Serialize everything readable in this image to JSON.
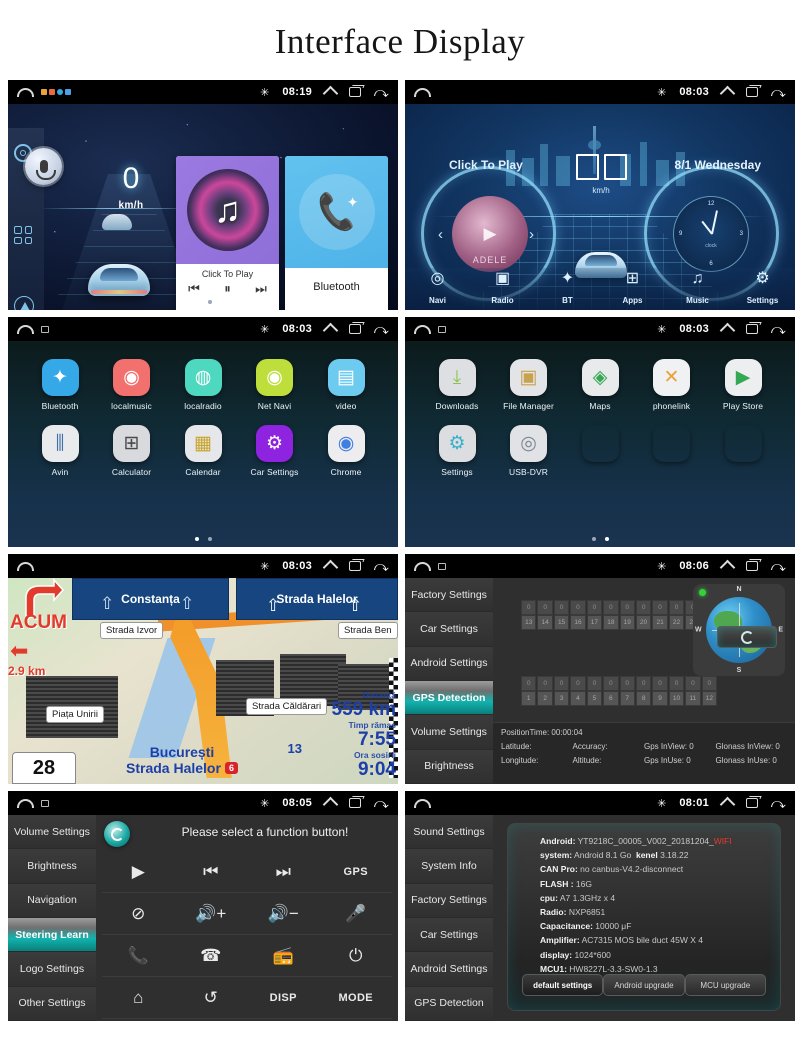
{
  "page": {
    "title": "Interface Display"
  },
  "status_bar": {
    "home_icon": "home-arc-icon",
    "recents_icon": "recents-icon",
    "back_icon": "back-icon",
    "bluetooth_icon": "bluetooth-icon",
    "expand_icon": "chevron-up-icon",
    "times": {
      "p1": "08:19",
      "p2": "08:03",
      "p3": "08:03",
      "p4": "08:03",
      "p5": "08:03",
      "p6": "08:06",
      "p7": "08:05",
      "p8": "08:01"
    }
  },
  "panel1": {
    "name": "home-screen",
    "sidebar": [
      {
        "name": "gear-icon",
        "label": "Settings"
      },
      {
        "name": "mic-icon",
        "label": "Voice"
      },
      {
        "name": "apps-grid-icon",
        "label": "Apps"
      },
      {
        "name": "navigation-icon",
        "label": "Navi"
      }
    ],
    "speed": {
      "value": "0",
      "unit": "km/h"
    },
    "music_widget": {
      "caption": "Click To Play",
      "prev": "⏮",
      "play_pause": "⏸",
      "next": "⏭"
    },
    "bluetooth_widget": {
      "label": "Bluetooth"
    },
    "page_dots": 2,
    "active_dot": 0
  },
  "panel2": {
    "name": "dashboard-screen",
    "click_to_play": "Click To Play",
    "date": "8/1  Wednesday",
    "speed_unit": "km/h",
    "album_name": "ADELE",
    "clock_label": "clock",
    "clock_ticks": [
      "12",
      "3",
      "6",
      "9"
    ],
    "nav_items": [
      {
        "label": "Navi",
        "icon": "location-pin-icon",
        "glyph": "◎"
      },
      {
        "label": "Radio",
        "icon": "radio-icon",
        "glyph": "▣"
      },
      {
        "label": "BT",
        "icon": "bluetooth-icon",
        "glyph": "✦"
      },
      {
        "label": "Apps",
        "icon": "apps-grid-icon",
        "glyph": "⊞"
      },
      {
        "label": "Music",
        "icon": "music-note-icon",
        "glyph": "♫"
      },
      {
        "label": "Settings",
        "icon": "gear-icon",
        "glyph": "⚙"
      }
    ]
  },
  "panel3": {
    "name": "app-drawer-page-1",
    "rows": [
      [
        {
          "label": "Bluetooth",
          "icon": "bluetooth-icon",
          "glyph": "✦",
          "bg": "#35a9e8",
          "fg": "#ffffff"
        },
        {
          "label": "localmusic",
          "icon": "music-play-icon",
          "glyph": "◉",
          "bg": "#f2706e",
          "fg": "#ffffff"
        },
        {
          "label": "localradio",
          "icon": "radio-icon",
          "glyph": "◍",
          "bg": "#4ed8bf",
          "fg": "#ffffff"
        },
        {
          "label": "Net Navi",
          "icon": "location-pin-icon",
          "glyph": "◉",
          "bg": "#bede3c",
          "fg": "#ffffff"
        },
        {
          "label": "video",
          "icon": "clapperboard-icon",
          "glyph": "▤",
          "bg": "#6ecbf0",
          "fg": "#ffffff"
        }
      ],
      [
        {
          "label": "Avin",
          "icon": "avin-icon",
          "glyph": "⫼",
          "bg": "#e9eaec",
          "fg": "#3e6fa8"
        },
        {
          "label": "Calculator",
          "icon": "calculator-icon",
          "glyph": "⊞",
          "bg": "#d9dadd",
          "fg": "#4a4a4a"
        },
        {
          "label": "Calendar",
          "icon": "calendar-icon",
          "glyph": "▦",
          "bg": "#e6e7ea",
          "fg": "#c9a227"
        },
        {
          "label": "Car Settings",
          "icon": "gear-icon",
          "glyph": "⚙",
          "bg": "#8e24e0",
          "fg": "#ffffff"
        },
        {
          "label": "Chrome",
          "icon": "chrome-icon",
          "glyph": "◉",
          "bg": "#ededef",
          "fg": "#3f7fe0"
        }
      ]
    ],
    "page_dots": 2,
    "active_dot": 0
  },
  "panel4": {
    "name": "app-drawer-page-2",
    "rows": [
      [
        {
          "label": "Downloads",
          "icon": "download-icon",
          "glyph": "⤓",
          "bg": "#dedfe2",
          "fg": "#8bc34a"
        },
        {
          "label": "File Manager",
          "icon": "file-manager-icon",
          "glyph": "▣",
          "bg": "#e3e4e7",
          "fg": "#c8a24c"
        },
        {
          "label": "Maps",
          "icon": "maps-icon",
          "glyph": "◈",
          "bg": "#e9eaec",
          "fg": "#34a853"
        },
        {
          "label": "phonelink",
          "icon": "phonelink-icon",
          "glyph": "✕",
          "bg": "#f0f1f3",
          "fg": "#e8a33d"
        },
        {
          "label": "Play Store",
          "icon": "play-store-icon",
          "glyph": "▶",
          "bg": "#eceef0",
          "fg": "#34a853"
        }
      ],
      [
        {
          "label": "Settings",
          "icon": "gear-icon",
          "glyph": "⚙",
          "bg": "#dcdde0",
          "fg": "#3bb0c9"
        },
        {
          "label": "USB-DVR",
          "icon": "dvr-camera-icon",
          "glyph": "◎",
          "bg": "#e1e2e5",
          "fg": "#7c8792"
        },
        {
          "label": "",
          "icon": "",
          "glyph": "",
          "bg": "transparent",
          "fg": "transparent"
        },
        {
          "label": "",
          "icon": "",
          "glyph": "",
          "bg": "transparent",
          "fg": "transparent"
        },
        {
          "label": "",
          "icon": "",
          "glyph": "",
          "bg": "transparent",
          "fg": "transparent"
        }
      ]
    ],
    "page_dots": 2,
    "active_dot": 1
  },
  "panel5": {
    "name": "navigation-map",
    "sign_left": "Constanța",
    "sign_right": "Strada Halelor",
    "instruction": "ACUM",
    "instruction_distance": "2.9 km",
    "speed_limit": "28",
    "labels": {
      "street_top": "Strada Izvor",
      "street_mid": "Piața Unirii",
      "street_right": "Strada Căldărari",
      "street_far_right": "Strada Ben"
    },
    "destination_city": "București",
    "destination_street": "Strada Halelor",
    "road_shield": "6",
    "waypoint_number": "13",
    "eta": [
      {
        "key": "Distanță",
        "value": "559 km"
      },
      {
        "key": "Timp rămas",
        "value": "7:55"
      },
      {
        "key": "Ora sosirii",
        "value": "9:04"
      }
    ]
  },
  "panel6": {
    "name": "gps-detection-settings",
    "nav": [
      "Factory Settings",
      "Car Settings",
      "Android Settings",
      "GPS Detection",
      "Volume Settings",
      "Brightness"
    ],
    "active_nav": "GPS Detection",
    "sat_group_upper": {
      "values": [
        "0",
        "0",
        "0",
        "0",
        "0",
        "0",
        "0",
        "0",
        "0",
        "0",
        "0",
        "0"
      ],
      "ids": [
        "13",
        "14",
        "15",
        "16",
        "17",
        "18",
        "19",
        "20",
        "21",
        "22",
        "23",
        "24"
      ]
    },
    "sat_group_lower": {
      "values": [
        "0",
        "0",
        "0",
        "0",
        "0",
        "0",
        "0",
        "0",
        "0",
        "0",
        "0",
        "0"
      ],
      "ids": [
        "1",
        "2",
        "3",
        "4",
        "5",
        "6",
        "7",
        "8",
        "9",
        "10",
        "11",
        "12"
      ]
    },
    "compass": {
      "n": "N",
      "s": "S",
      "e": "E",
      "w": "W"
    },
    "refresh_button": "refresh-icon",
    "info": {
      "position_time": "PositionTime: 00:00:04",
      "row1": [
        "Latitude:",
        "Accuracy:",
        "Gps InView: 0",
        "Glonass InView: 0"
      ],
      "row2": [
        "Longitude:",
        "Altitude:",
        "Gps InUse: 0",
        "Glonass InUse: 0"
      ]
    }
  },
  "panel7": {
    "name": "steering-learn-settings",
    "nav": [
      "Volume Settings",
      "Brightness",
      "Navigation",
      "Steering Learn",
      "Logo Settings",
      "Other Settings"
    ],
    "active_nav": "Steering Learn",
    "title": "Please select a function button!",
    "reset_icon": "refresh-icon",
    "buttons": [
      {
        "name": "play-button",
        "glyph": "▶",
        "text": false
      },
      {
        "name": "previous-button",
        "glyph": "⏮",
        "text": false
      },
      {
        "name": "next-button",
        "glyph": "⏭",
        "text": false
      },
      {
        "name": "gps-button",
        "glyph": "GPS",
        "text": true
      },
      {
        "name": "mute-button",
        "glyph": "⊘",
        "text": false
      },
      {
        "name": "volume-up-button",
        "glyph": "🔊+",
        "text": false
      },
      {
        "name": "volume-down-button",
        "glyph": "🔊−",
        "text": false
      },
      {
        "name": "mic-button",
        "glyph": "🎤",
        "text": false
      },
      {
        "name": "call-answer-button",
        "glyph": "📞",
        "text": false
      },
      {
        "name": "call-end-button",
        "glyph": "☎",
        "text": false
      },
      {
        "name": "radio-button",
        "glyph": "📻",
        "text": false
      },
      {
        "name": "power-button",
        "glyph": "⏻",
        "text": false
      },
      {
        "name": "home-button",
        "glyph": "⌂",
        "text": false
      },
      {
        "name": "back-button",
        "glyph": "↺",
        "text": false
      },
      {
        "name": "disp-button",
        "glyph": "DISP",
        "text": true
      },
      {
        "name": "mode-button",
        "glyph": "MODE",
        "text": true
      }
    ]
  },
  "panel8": {
    "name": "system-info-settings",
    "nav": [
      "Sound Settings",
      "System Info",
      "Factory Settings",
      "Car Settings",
      "Android Settings",
      "GPS Detection"
    ],
    "active_nav": "System Info",
    "info_rows": [
      {
        "key": "Android:",
        "value": "YT9218C_00005_V002_20181204_",
        "suffix": "WIFI"
      },
      {
        "key": "system:",
        "value": "Android 8.1 Go",
        "key2": "kenel",
        "value2": "3.18.22"
      },
      {
        "key": "CAN Pro:",
        "value": "no canbus-V4.2-disconnect"
      },
      {
        "key": "FLASH :",
        "value": "16G"
      },
      {
        "key": "cpu:",
        "value": "A7 1.3GHz x 4"
      },
      {
        "key": "Radio:",
        "value": "NXP6851"
      },
      {
        "key": "Capacitance:",
        "value": "10000 μF"
      },
      {
        "key": "Amplifier:",
        "value": "AC7315 MOS bile duct 45W X 4"
      },
      {
        "key": "display:",
        "value": "1024*600"
      },
      {
        "key": "MCU1:",
        "value": "HW8227L-3.3-SW0-1.3"
      }
    ],
    "buttons": [
      "default settings",
      "Android upgrade",
      "MCU upgrade"
    ]
  }
}
